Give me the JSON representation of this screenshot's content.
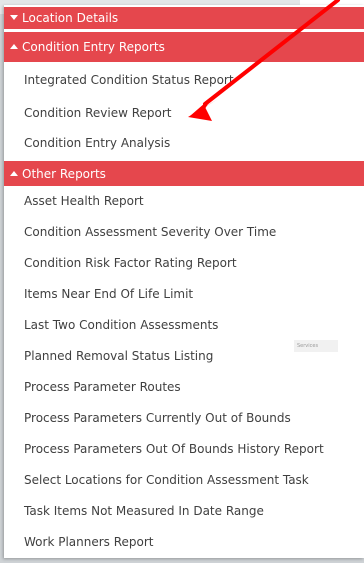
{
  "menu": {
    "location_details": "Location Details",
    "condition_entry": {
      "title": "Condition Entry Reports",
      "items": [
        "Integrated Condition Status Report",
        "Condition Review Report",
        "Condition Entry Analysis"
      ]
    },
    "other_reports": {
      "title": "Other Reports",
      "items": [
        "Asset Health Report",
        "Condition Assessment Severity Over Time",
        "Condition Risk Factor Rating Report",
        "Items Near End Of Life Limit",
        "Last Two Condition Assessments",
        "Planned Removal Status Listing",
        "Process Parameter Routes",
        "Process Parameters Currently Out of Bounds",
        "Process Parameters Out Of Bounds History Report",
        "Select Locations for Condition Assessment Task",
        "Task Items Not Measured In Date Range",
        "Work Planners Report"
      ]
    },
    "services_tag": "Services"
  },
  "annotation": {
    "arrow_color": "#ff0000",
    "arrow_target": "Condition Review Report"
  },
  "colors": {
    "section_header": "#e5474d",
    "item_text": "#404040"
  }
}
